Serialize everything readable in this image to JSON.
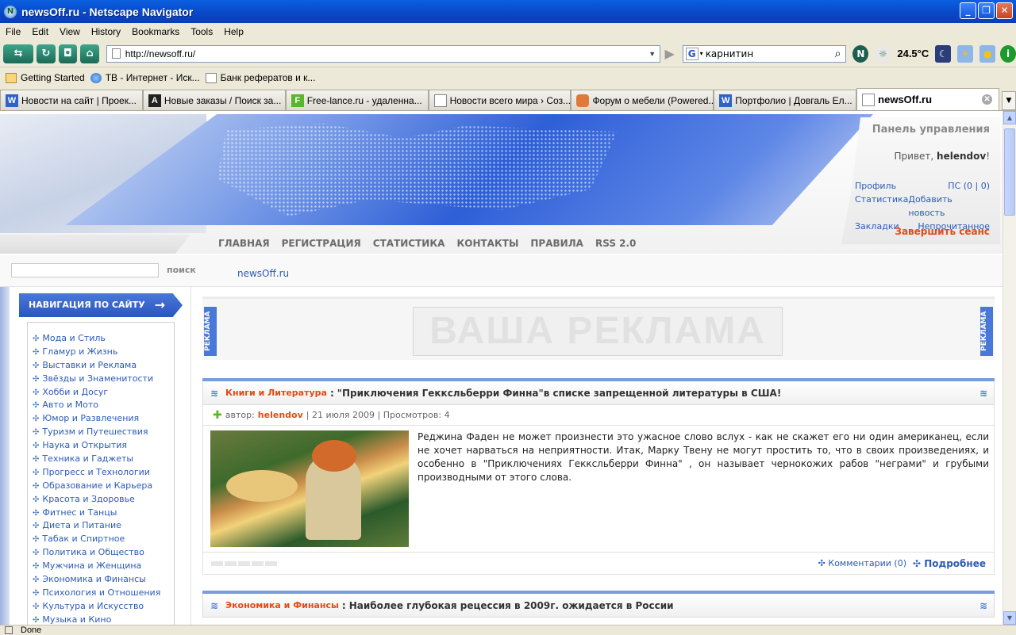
{
  "window": {
    "title": "newsOff.ru - Netscape Navigator"
  },
  "menu": [
    "File",
    "Edit",
    "View",
    "History",
    "Bookmarks",
    "Tools",
    "Help"
  ],
  "toolbar": {
    "url": "http://newsoff.ru/",
    "search_value": "карнитин",
    "temperature": "24.5°C"
  },
  "bookmarks": [
    "Getting Started",
    "ТВ - Интернет - Иск...",
    "Банк рефератов и к..."
  ],
  "tabs": [
    {
      "label": "Новости на сайт | Проек...",
      "icon": "W",
      "color": "#2f63c8"
    },
    {
      "label": "Новые заказы / Поиск за...",
      "icon": "A",
      "color": "#222"
    },
    {
      "label": "Free-lance.ru - удаленна...",
      "icon": "F",
      "color": "#5ab52b"
    },
    {
      "label": "Новости всего мира › Соз...",
      "icon": "",
      "color": "#fff"
    },
    {
      "label": "Форум о мебели (Powered...",
      "icon": "",
      "color": "#e07a3a"
    },
    {
      "label": "Портфолио | Довгаль Ел...",
      "icon": "W",
      "color": "#2f63c8"
    },
    {
      "label": "newsOff.ru",
      "icon": "",
      "color": "#fff"
    }
  ],
  "header": {
    "panel_title": "Панель управления",
    "greeting": "Привет,",
    "username": "helendov",
    "greeting_end": "!",
    "links": [
      [
        "Профиль",
        "ПС (0 | 0)"
      ],
      [
        "Статистика",
        "Добавить новость"
      ],
      [
        "Закладки",
        "Непрочитанное"
      ]
    ],
    "logout": "Завершить сеанс",
    "nav": [
      "ГЛАВНАЯ",
      "РЕГИСТРАЦИЯ",
      "СТАТИСТИКА",
      "КОНТАКТЫ",
      "ПРАВИЛА",
      "RSS 2.0"
    ]
  },
  "search": {
    "button": "поиск"
  },
  "breadcrumb": "newsOff.ru",
  "sidebar": {
    "title": "НАВИГАЦИЯ ПО САЙТУ",
    "items": [
      "Мода и Стиль",
      "Гламур и Жизнь",
      "Выставки и Реклама",
      "Звёзды и Знаменитости",
      "Хобби и Досуг",
      "Авто и Мото",
      "Юмор и Развлечения",
      "Туризм и Путешествия",
      "Наука и Открытия",
      "Техника и Гаджеты",
      "Прогресс и Технологии",
      "Образование и Карьера",
      "Красота и Здоровье",
      "Фитнес и Танцы",
      "Диета и Питание",
      "Табак и Спиртное",
      "Политика и Общество",
      "Мужчина и Женщина",
      "Экономика и Финансы",
      "Психология и Отношения",
      "Культура и Искусство",
      "Музыка и Кино"
    ]
  },
  "ad": {
    "text": "ВАША РЕКЛАМА",
    "side": "РЕКЛАМА"
  },
  "news": [
    {
      "category": "Книги и Литература",
      "title": "\"Приключения Гекксльберри Финна\"в списке запрещенной литературы в США!",
      "author_label": "автор:",
      "author": "helendov",
      "meta": "| 21 июля 2009 | Просмотров: 4",
      "text": "Реджина Фаден не может произнести это ужасное слово вслух - как не скажет его ни один американец, если не хочет нарваться на неприятности. Итак, Марку Твену не могут простить то, что в своих произведениях, и особенно в \"Приключениях Гекксльберри Финна\" , он называет чернокожих рабов \"неграми\" и грубыми производными от этого слова.",
      "comments": "Комментарии (0)",
      "more": "Подробнее"
    },
    {
      "category": "Экономика и Финансы",
      "title": "Наиболее глубокая рецессия в 2009г. ожидается в России"
    }
  ],
  "status": "Done"
}
